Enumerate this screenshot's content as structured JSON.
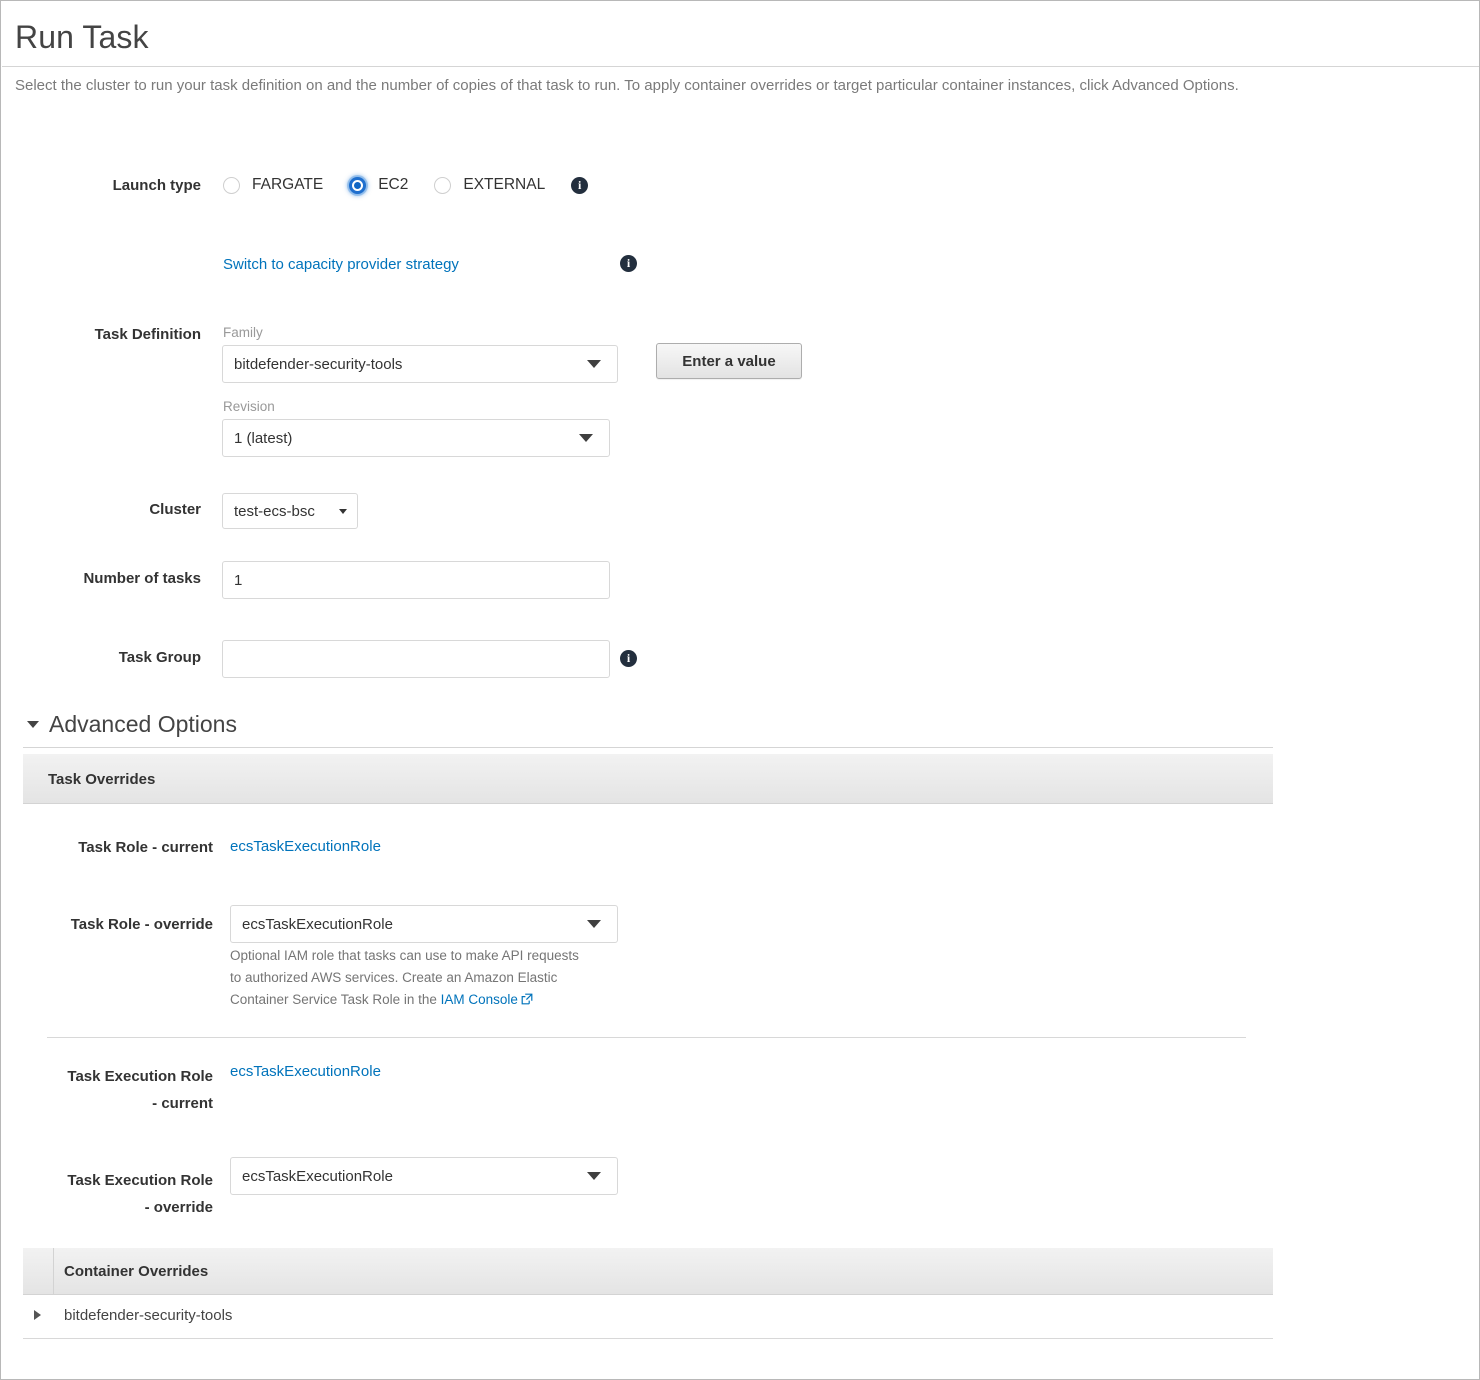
{
  "header": {
    "title": "Run Task",
    "description": "Select the cluster to run your task definition on and the number of copies of that task to run. To apply container overrides or target particular container instances, click Advanced Options."
  },
  "launch_type": {
    "label": "Launch type",
    "options": [
      {
        "label": "FARGATE",
        "selected": false
      },
      {
        "label": "EC2",
        "selected": true
      },
      {
        "label": "EXTERNAL",
        "selected": false
      }
    ],
    "info_icon": "info-icon",
    "capacity_provider_link": "Switch to capacity provider strategy",
    "capacity_provider_info_icon": "info-icon"
  },
  "task_definition": {
    "label": "Task Definition",
    "family_label": "Family",
    "family_value": "bitdefender-security-tools",
    "revision_label": "Revision",
    "revision_value": "1 (latest)",
    "enter_value_button": "Enter a value"
  },
  "cluster": {
    "label": "Cluster",
    "value": "test-ecs-bsc"
  },
  "number_of_tasks": {
    "label": "Number of tasks",
    "value": "1"
  },
  "task_group": {
    "label": "Task Group",
    "value": "",
    "placeholder": "",
    "info_icon": "info-icon"
  },
  "advanced_options": {
    "title": "Advanced Options",
    "expanded": true,
    "task_overrides": {
      "section_title": "Task Overrides",
      "task_role_current_label": "Task Role - current",
      "task_role_current_value": "ecsTaskExecutionRole",
      "task_role_override_label": "Task Role - override",
      "task_role_override_value": "ecsTaskExecutionRole",
      "task_role_help_1": "Optional IAM role that tasks can use to make API requests",
      "task_role_help_2": "to authorized AWS services. Create an Amazon Elastic",
      "task_role_help_3": "Container Service Task Role in the ",
      "task_role_help_link": "IAM Console",
      "task_exec_role_current_label_line1": "Task Execution Role",
      "task_exec_role_current_label_line2": "- current",
      "task_exec_role_current_value": "ecsTaskExecutionRole",
      "task_exec_role_override_label_line1": "Task Execution Role",
      "task_exec_role_override_label_line2": "- override",
      "task_exec_role_override_value": "ecsTaskExecutionRole"
    },
    "container_overrides": {
      "section_title": "Container Overrides",
      "rows": [
        {
          "name": "bitdefender-security-tools",
          "expanded": false
        }
      ]
    }
  },
  "colors": {
    "link": "#0073bb",
    "accent_radio": "#1166c4",
    "text": "#333333",
    "muted": "#999999",
    "section_bar": "#e9e9e9"
  }
}
